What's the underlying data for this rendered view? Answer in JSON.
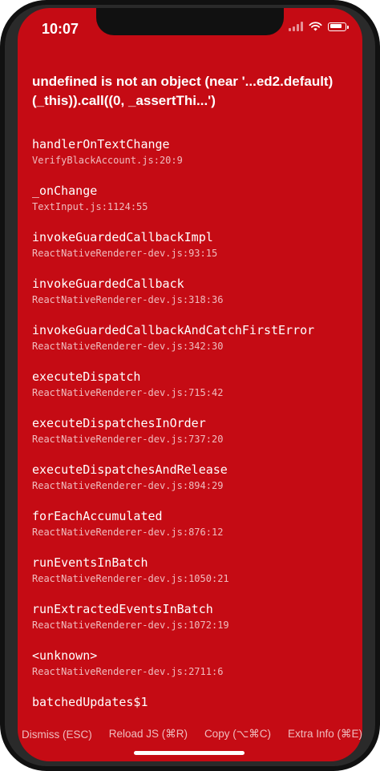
{
  "status_bar": {
    "time": "10:07",
    "battery_level": 0.85
  },
  "error": {
    "message": "undefined is not an object (near '...ed2.default)(_this)).call((0, _assertThi...')"
  },
  "stack": [
    {
      "method": "handlerOnTextChange",
      "location": "VerifyBlackAccount.js:20:9"
    },
    {
      "method": "_onChange",
      "location": "TextInput.js:1124:55"
    },
    {
      "method": "invokeGuardedCallbackImpl",
      "location": "ReactNativeRenderer-dev.js:93:15"
    },
    {
      "method": "invokeGuardedCallback",
      "location": "ReactNativeRenderer-dev.js:318:36"
    },
    {
      "method": "invokeGuardedCallbackAndCatchFirstError",
      "location": "ReactNativeRenderer-dev.js:342:30"
    },
    {
      "method": "executeDispatch",
      "location": "ReactNativeRenderer-dev.js:715:42"
    },
    {
      "method": "executeDispatchesInOrder",
      "location": "ReactNativeRenderer-dev.js:737:20"
    },
    {
      "method": "executeDispatchesAndRelease",
      "location": "ReactNativeRenderer-dev.js:894:29"
    },
    {
      "method": "forEachAccumulated",
      "location": "ReactNativeRenderer-dev.js:876:12"
    },
    {
      "method": "runEventsInBatch",
      "location": "ReactNativeRenderer-dev.js:1050:21"
    },
    {
      "method": "runExtractedEventsInBatch",
      "location": "ReactNativeRenderer-dev.js:1072:19"
    },
    {
      "method": "<unknown>",
      "location": "ReactNativeRenderer-dev.js:2711:6"
    },
    {
      "method": "batchedUpdates$1",
      "location": ""
    }
  ],
  "footer": {
    "dismiss": "Dismiss (ESC)",
    "reload": "Reload JS (⌘R)",
    "copy": "Copy (⌥⌘C)",
    "extra_info": "Extra Info (⌘E)"
  },
  "colors": {
    "background": "#c50b14",
    "text": "#ffffff"
  },
  "icons": {
    "signal": "cellular-signal-icon",
    "wifi": "wifi-icon",
    "battery": "battery-icon"
  }
}
